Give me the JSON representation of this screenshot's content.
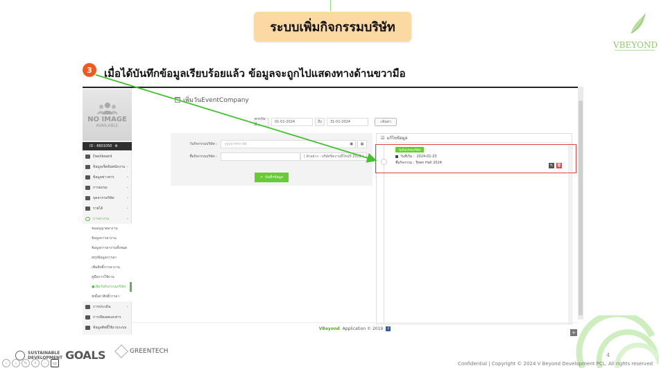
{
  "slide": {
    "title": "ระบบเพิ่มกิจกรรมบริษัท",
    "step_number": "3",
    "step_text": "เมื่อได้บันทึกข้อมูลเรียบร้อยแล้ว ข้อมูลจะถูกไปแสดงทางด้านขวามือ",
    "page_number": "4",
    "confidential": "Confidential | Copyright ©  2024 V Beyond Development PCL. All rights reserved",
    "logo_word": "VBEYOND",
    "sdg_line1": "SUSTAINABLE",
    "sdg_line2": "DEVELOPMENT",
    "sdg_goals": "GOALS",
    "greentech": "GREENTECH"
  },
  "sidebar": {
    "no_image": "NO IMAGE",
    "available": "AVAILABLE",
    "user_id": "ID : 6601050",
    "items": [
      {
        "label": "Dashboard"
      },
      {
        "label": "ข้อมูลเช็คอินพนักงาน"
      },
      {
        "label": "ข้อมูลข่าวสาร"
      },
      {
        "label": "การอบรม"
      },
      {
        "label": "บุคลากรบริษัท"
      },
      {
        "label": "รายได้"
      },
      {
        "label": "การลางาน"
      }
    ],
    "sub_items": [
      {
        "label": "ขออนุญาตลางาน"
      },
      {
        "label": "ข้อมูลการลางาน"
      },
      {
        "label": "ข้อมูลการลางานทั้งหมด"
      },
      {
        "label": "สรุปข้อมูลการลา"
      },
      {
        "label": "เพิ่มสิทธิ์การลางาน"
      },
      {
        "label": "คู่มือการใช้งาน"
      },
      {
        "label": "เพิ่มวันกิจกรรมบริษัท"
      },
      {
        "label": "ตั้งค่าสิทธิ์การลา"
      }
    ],
    "bottom_items": [
      {
        "label": "การประเมิน"
      },
      {
        "label": "การเปิดเผยเอกสาร"
      },
      {
        "label": "ข้อมูลสิทธิ์ใช้งานระบบ"
      }
    ]
  },
  "page": {
    "heading": "เพิ่มวันEventCompany",
    "filter": {
      "from_label": "จากวันที่",
      "from_value": "01-01-2024",
      "to_label": "ถึง",
      "to_value": "31-01-2024",
      "search_button": "ค้นหา"
    },
    "form": {
      "date_label": "วันกิจกรรมบริษัท :",
      "date_placeholder": "yyyy-mm-dd",
      "name_label": "ชื่อกิจกรรมบริษัท :",
      "name_hint": "( ตัวอย่าง : บริษัทปิดงานปีใหม่ปี 2022 )",
      "save_button": "บันทึกข้อมูล"
    },
    "list": {
      "heading": "แก้ไขข้อมูล",
      "items": [
        {
          "tag": "วันกิจกรรมบริษัท",
          "date_label": "วันที่เริ่ม :",
          "date": "2024-01-23",
          "name_label": "ชื่อกิจกรรม :",
          "name": "Town Hall 2024"
        }
      ]
    },
    "footer": {
      "brand": "VBeyond",
      "text": "Application © 2019"
    }
  },
  "colors": {
    "accent_green": "#66cc33",
    "banner": "#fcd9a3",
    "step_badge": "#f05a1e",
    "highlight": "#e0423f",
    "arrow": "#3fc22a"
  }
}
